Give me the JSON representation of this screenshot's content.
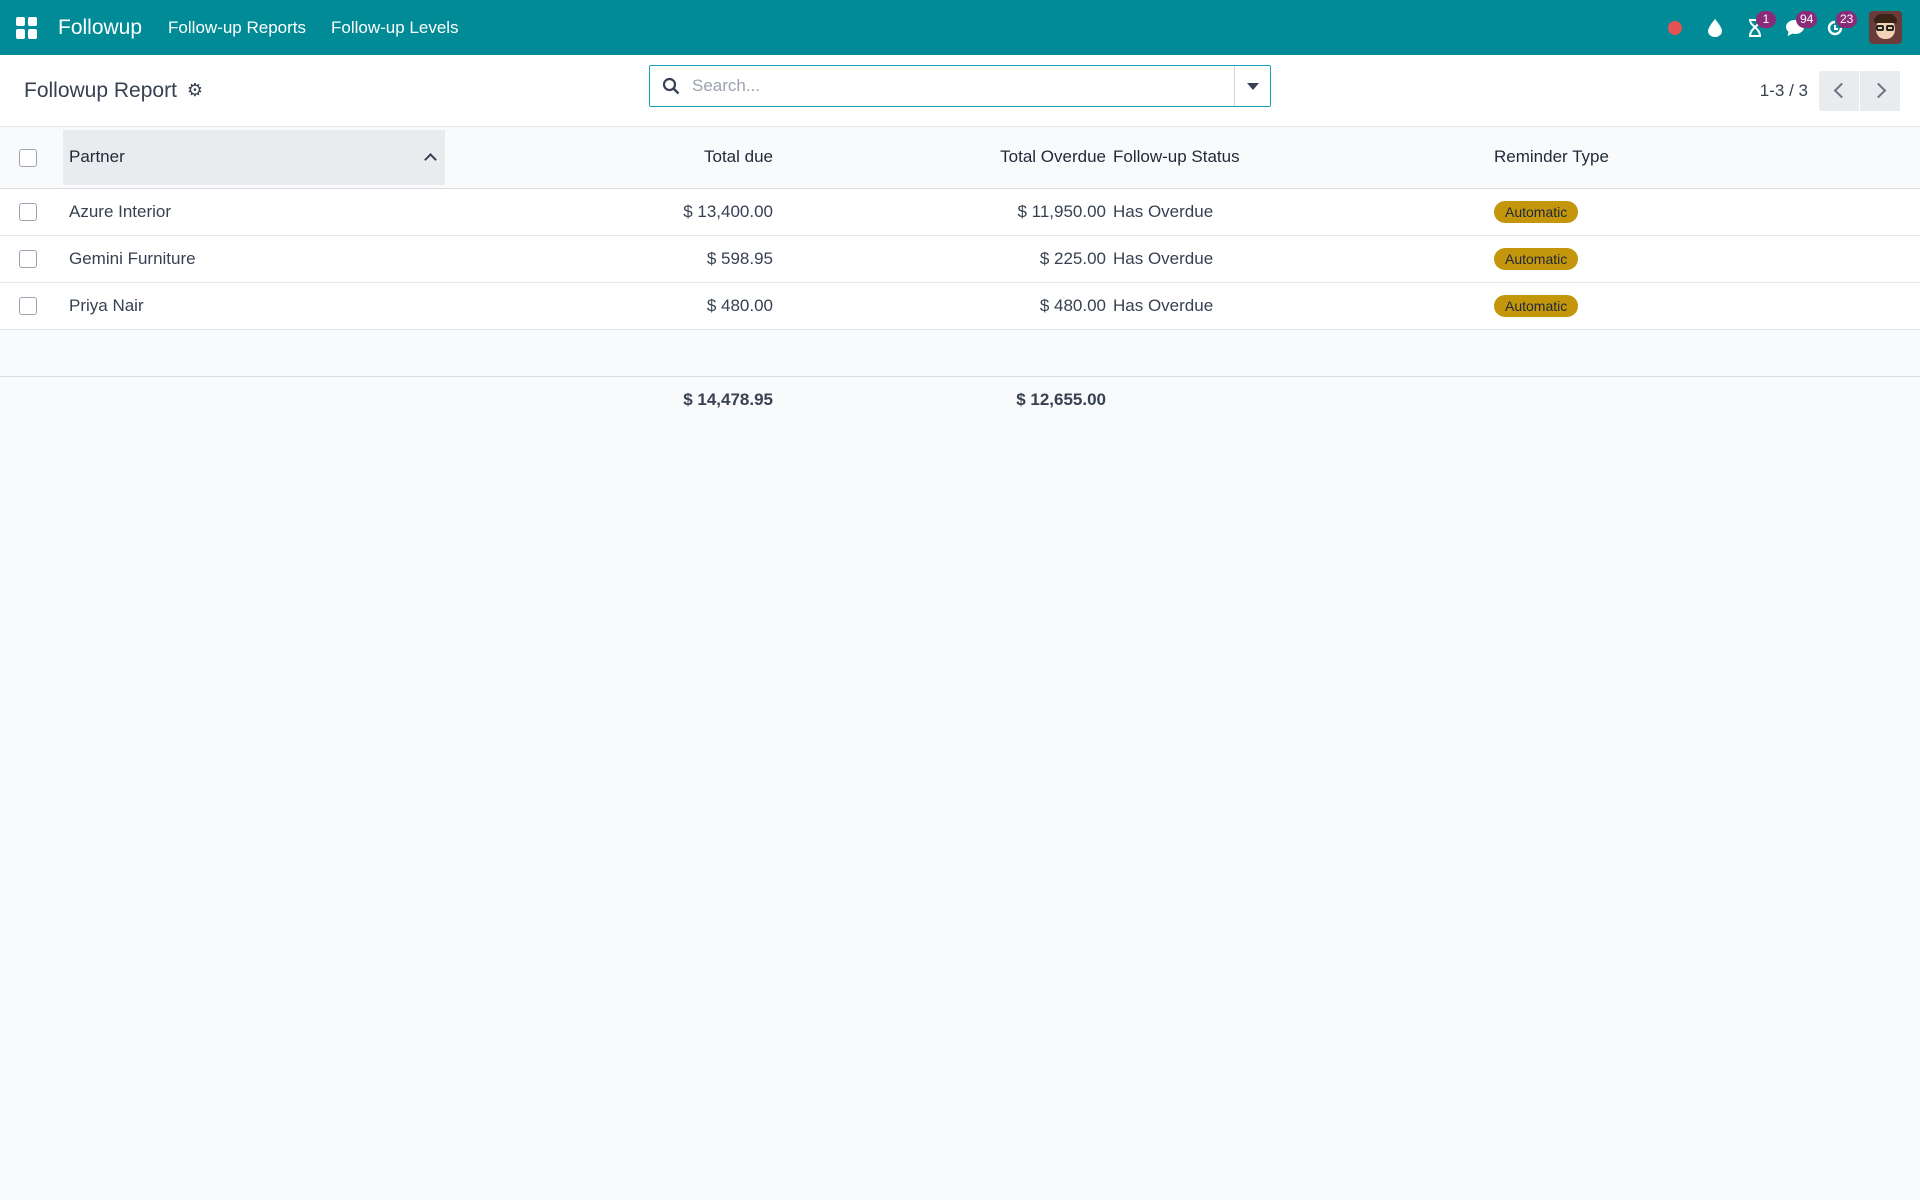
{
  "navbar": {
    "app_name": "Followup",
    "menus": [
      "Follow-up Reports",
      "Follow-up Levels"
    ],
    "activity_count": "1",
    "messages_count": "94",
    "updates_count": "23"
  },
  "control_panel": {
    "title": "Followup Report",
    "search_placeholder": "Search...",
    "pager": "1-3 / 3"
  },
  "table": {
    "headers": {
      "partner": "Partner",
      "total_due": "Total due",
      "total_overdue": "Total Overdue",
      "status": "Follow-up Status",
      "reminder_type": "Reminder Type"
    },
    "rows": [
      {
        "partner": "Azure Interior",
        "total_due": "$ 13,400.00",
        "total_overdue": "$ 11,950.00",
        "status": "Has Overdue",
        "reminder_type": "Automatic"
      },
      {
        "partner": "Gemini Furniture",
        "total_due": "$ 598.95",
        "total_overdue": "$ 225.00",
        "status": "Has Overdue",
        "reminder_type": "Automatic"
      },
      {
        "partner": "Priya Nair",
        "total_due": "$ 480.00",
        "total_overdue": "$ 480.00",
        "status": "Has Overdue",
        "reminder_type": "Automatic"
      }
    ],
    "totals": {
      "total_due": "$ 14,478.95",
      "total_overdue": "$ 12,655.00"
    }
  },
  "colors": {
    "navbar": "#018b96",
    "badge": "#c4960c",
    "counter_badge": "#8c2a7a",
    "recording": "#e45353"
  }
}
